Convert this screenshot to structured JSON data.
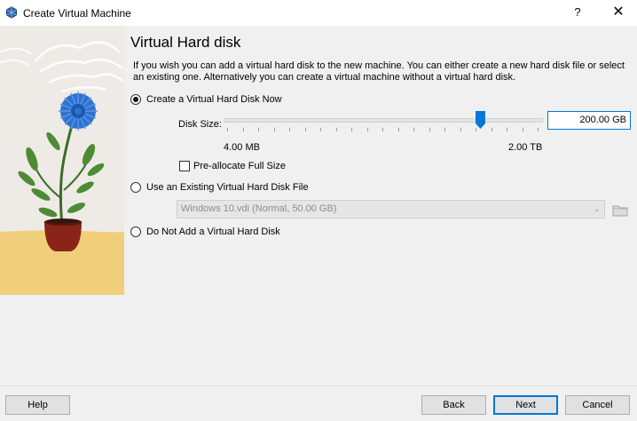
{
  "window": {
    "title": "Create Virtual Machine",
    "help_glyph": "?",
    "close_glyph": "✕",
    "icon": "virtualbox-icon"
  },
  "page": {
    "heading": "Virtual Hard disk",
    "description": "If you wish you can add a virtual hard disk to the new machine. You can either create a new hard disk file or select an existing one. Alternatively you can create a virtual machine without a virtual hard disk."
  },
  "options": {
    "create_now": {
      "label": "Create a Virtual Hard Disk Now",
      "selected": true
    },
    "use_existing": {
      "label": "Use an Existing Virtual Hard Disk File",
      "selected": false
    },
    "no_disk": {
      "label": "Do Not Add a Virtual Hard Disk",
      "selected": false
    }
  },
  "disk_size": {
    "label": "Disk Size:",
    "value": "200.00 GB",
    "min_label": "4.00 MB",
    "max_label": "2.00 TB",
    "slider_fraction": 0.81
  },
  "preallocate": {
    "label": "Pre-allocate Full Size",
    "checked": false
  },
  "existing_file": {
    "selected": "Windows 10.vdi (Normal, 50.00 GB)",
    "enabled": false
  },
  "buttons": {
    "help": "Help",
    "back": "Back",
    "next": "Next",
    "cancel": "Cancel"
  },
  "colors": {
    "accent": "#0078d7",
    "flower_blue": "#2f72d1",
    "pot": "#8a2418"
  }
}
